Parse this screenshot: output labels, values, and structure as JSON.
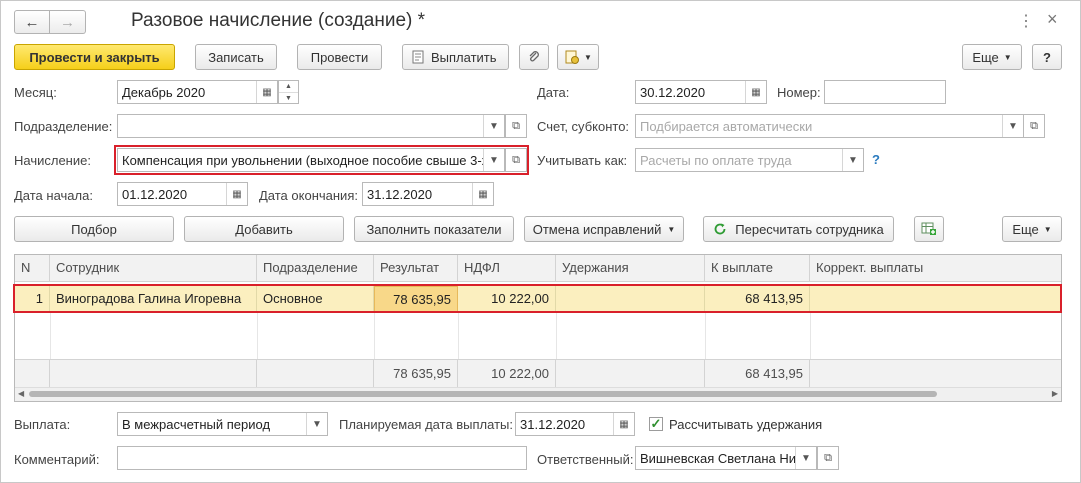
{
  "window": {
    "title": "Разовое начисление (создание) *",
    "back_icon": "←",
    "forward_icon": "→",
    "menu_icon": "⋮",
    "close_icon": "×"
  },
  "toolbar": {
    "post_and_close": "Провести и закрыть",
    "save": "Записать",
    "post": "Провести",
    "pay": "Выплатить",
    "more": "Еще",
    "help": "?"
  },
  "form": {
    "month_label": "Месяц:",
    "month_value": "Декабрь 2020",
    "date_label": "Дата:",
    "date_value": "30.12.2020",
    "number_label": "Номер:",
    "number_value": "",
    "division_label": "Подразделение:",
    "division_value": "",
    "account_label": "Счет, субконто:",
    "account_placeholder": "Подбирается автоматически",
    "accrual_label": "Начисление:",
    "accrual_value": "Компенсация при увольнении (выходное пособие свыше 3-х",
    "account_as_label": "Учитывать как:",
    "account_as_placeholder": "Расчеты по оплате труда",
    "help_mark": "?",
    "start_label": "Дата начала:",
    "start_value": "01.12.2020",
    "end_label": "Дата окончания:",
    "end_value": "31.12.2020"
  },
  "table_toolbar": {
    "pick": "Подбор",
    "add": "Добавить",
    "fill": "Заполнить показатели",
    "cancel_fix": "Отмена исправлений",
    "recalc": "Пересчитать сотрудника",
    "more": "Еще"
  },
  "table": {
    "headers": [
      "N",
      "Сотрудник",
      "Подразделение",
      "Результат",
      "НДФЛ",
      "Удержания",
      "К выплате",
      "Коррект. выплаты"
    ],
    "rows": [
      {
        "n": "1",
        "employee": "Виноградова Галина Игоревна",
        "division": "Основное",
        "result": "78 635,95",
        "ndfl": "10 222,00",
        "deductions": "",
        "to_pay": "68 413,95",
        "correction": ""
      }
    ],
    "totals": {
      "result": "78 635,95",
      "ndfl": "10 222,00",
      "to_pay": "68 413,95"
    }
  },
  "bottom": {
    "payout_label": "Выплата:",
    "payout_value": "В межрасчетный период",
    "planned_date_label": "Планируемая дата выплаты:",
    "planned_date_value": "31.12.2020",
    "calc_deductions_label": "Рассчитывать удержания",
    "calc_deductions_checked": "✓",
    "comment_label": "Комментарий:",
    "comment_value": "",
    "responsible_label": "Ответственный:",
    "responsible_value": "Вишневская Светлана Ни"
  }
}
